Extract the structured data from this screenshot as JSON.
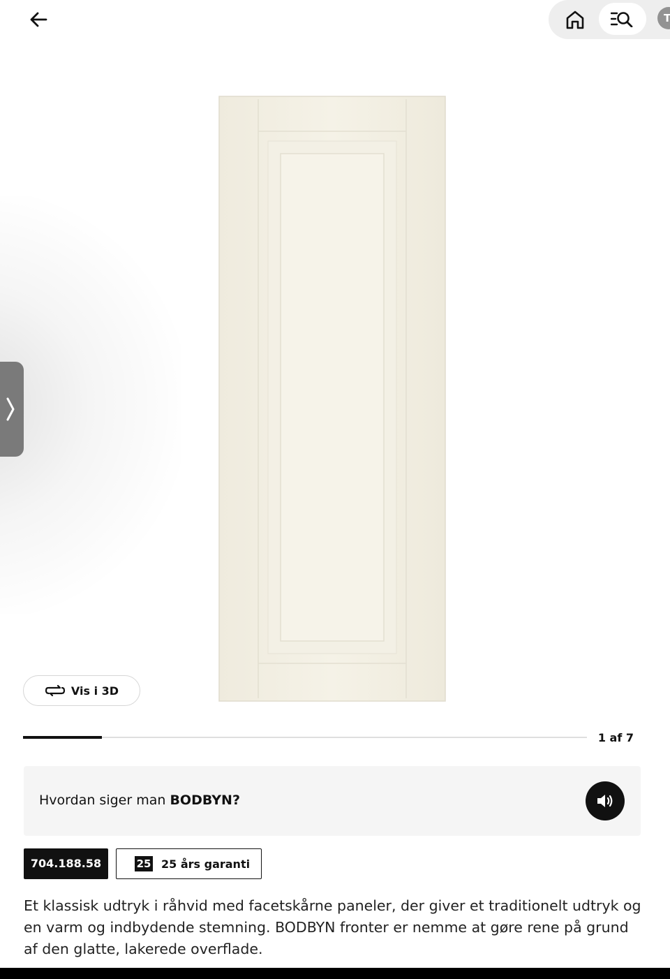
{
  "header": {
    "back_icon": "arrow-left-icon",
    "home_icon": "home-icon",
    "search_icon": "search-list-icon",
    "avatar_initial": "T"
  },
  "gallery": {
    "side_tab_icon": "chevron-right-icon",
    "vis3d_label": "Vis i 3D",
    "vis3d_icon": "rotate-3d-icon",
    "counter": "1 af 7",
    "progress": 0.14
  },
  "pronounce": {
    "prefix": "Hvordan siger man ",
    "name": "BODBYN?",
    "speaker_icon": "speaker-icon"
  },
  "tags": {
    "article_number": "704.188.58",
    "warranty_years": "25",
    "warranty_label": "25 års garanti"
  },
  "description": "Et klassisk udtryk i råhvid med facetskårne paneler, der giver et traditionelt udtryk og en varm og indbydende stemning. BODBYN fronter er nemme at gøre rene på grund af den glatte, lakerede overflade.",
  "colors": {
    "door": "#f3efe3",
    "accent_dark": "#111111",
    "pill_bg": "#eeeeee"
  }
}
